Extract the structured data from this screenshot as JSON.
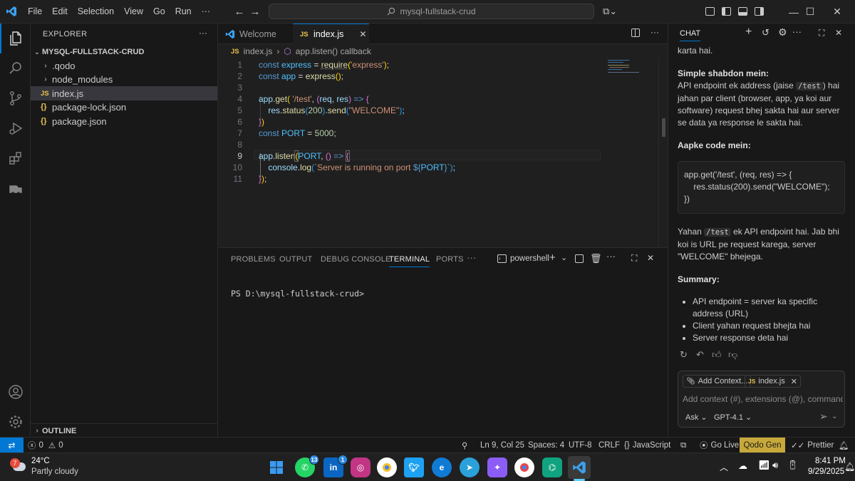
{
  "titlebar": {
    "menus": [
      "File",
      "Edit",
      "Selection",
      "View",
      "Go",
      "Run",
      "···"
    ],
    "search_text": "mysql-fullstack-crud"
  },
  "explorer": {
    "title": "EXPLORER",
    "more": "···",
    "project": "MYSQL-FULLSTACK-CRUD",
    "items": [
      {
        "label": ".qodo",
        "type": "folder"
      },
      {
        "label": "node_modules",
        "type": "folder"
      },
      {
        "label": "index.js",
        "type": "js",
        "badge": "JS"
      },
      {
        "label": "package-lock.json",
        "type": "json",
        "badge": "{}"
      },
      {
        "label": "package.json",
        "type": "json",
        "badge": "{}"
      }
    ],
    "outline": "OUTLINE"
  },
  "tabs": [
    {
      "label": "Welcome"
    },
    {
      "label": "index.js",
      "badge": "JS"
    }
  ],
  "breadcrumb": {
    "file": "index.js",
    "symbol": "app.listen() callback"
  },
  "editor": {
    "line_numbers": [
      "1",
      "2",
      "3",
      "4",
      "5",
      "6",
      "7",
      "8",
      "9",
      "10",
      "11"
    ]
  },
  "panel": {
    "tabs": [
      "PROBLEMS",
      "OUTPUT",
      "DEBUG CONSOLE",
      "TERMINAL",
      "PORTS",
      "···"
    ],
    "active_tab": "TERMINAL",
    "shell": "powershell",
    "prompt": "PS D:\\mysql-fullstack-crud>"
  },
  "chat": {
    "title": "CHAT",
    "intro_tail": "karta hai.",
    "h1": "Simple shabdon mein:",
    "p1_a": "API endpoint ek address (jaise ",
    "p1_code": "/test",
    "p1_b": ") hai jahan par client (browser, app, ya koi aur software) request bhej sakta hai aur server se data ya response le sakta hai.",
    "h2": "Aapke code mein:",
    "code_block": "app.get('/test', (req, res) => {\n    res.status(200).send(\"WELCOME\");\n})",
    "p2_a": "Yahan ",
    "p2_code": "/test",
    "p2_b": " ek API endpoint hai. Jab bhi koi is URL pe request karega, server \"WELCOME\" bhejega.",
    "h3": "Summary:",
    "bullets": [
      "API endpoint = server ka specific address (URL)",
      "Client yahan request bhejta hai",
      "Server response deta hai"
    ],
    "add_context": "Add Context...",
    "context_file": "index.js",
    "input_placeholder": "Add context (#), extensions (@), commands",
    "mode": "Ask",
    "model": "GPT-4.1"
  },
  "statusbar": {
    "errors": "0",
    "warnings": "0",
    "position": "Ln 9, Col 25",
    "spaces": "Spaces: 4",
    "encoding": "UTF-8",
    "eol": "CRLF",
    "language": "JavaScript",
    "go_live": "Go Live",
    "qodo": "Qodo Gen",
    "prettier": "Prettier"
  },
  "taskbar": {
    "temperature": "24°C",
    "weather": "Partly cloudy",
    "weather_badge": "7",
    "whatsapp_badge": "13",
    "linkedin_badge": "1",
    "time": "8:41 PM",
    "date": "9/29/2025"
  },
  "colors": {
    "accent": "#0078d4",
    "qodo_bg": "#c7a93b",
    "editor_bg": "#1f1f1f",
    "sidebar_bg": "#181818"
  }
}
